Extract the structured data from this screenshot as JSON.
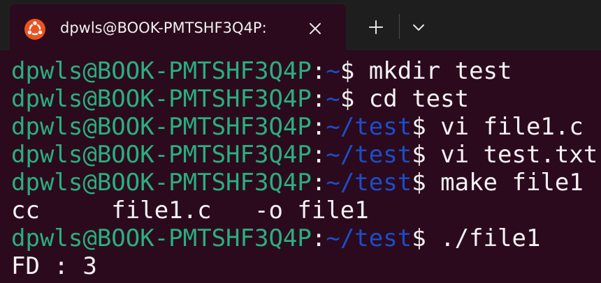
{
  "tab": {
    "icon": "ubuntu-logo-icon",
    "title": "dpwls@BOOK-PMTSHF3Q4P:"
  },
  "colors": {
    "background": "#2c0a1e",
    "titlebar": "#1e1e1e",
    "user_host": "#28b07f",
    "path": "#1a4ec9",
    "text": "#f3f3f3",
    "ubuntu_orange": "#e95420"
  },
  "lines": [
    {
      "type": "prompt",
      "user": "dpwls@BOOK-PMTSHF3Q4P",
      "path": "~",
      "cmd": " mkdir test"
    },
    {
      "type": "prompt",
      "user": "dpwls@BOOK-PMTSHF3Q4P",
      "path": "~",
      "cmd": " cd test"
    },
    {
      "type": "prompt",
      "user": "dpwls@BOOK-PMTSHF3Q4P",
      "path": "~/test",
      "cmd": " vi file1.c"
    },
    {
      "type": "prompt",
      "user": "dpwls@BOOK-PMTSHF3Q4P",
      "path": "~/test",
      "cmd": " vi test.txt"
    },
    {
      "type": "prompt",
      "user": "dpwls@BOOK-PMTSHF3Q4P",
      "path": "~/test",
      "cmd": " make file1"
    },
    {
      "type": "output",
      "text": "cc     file1.c   -o file1"
    },
    {
      "type": "prompt",
      "user": "dpwls@BOOK-PMTSHF3Q4P",
      "path": "~/test",
      "cmd": " ./file1"
    },
    {
      "type": "output",
      "text": "FD : 3"
    }
  ]
}
